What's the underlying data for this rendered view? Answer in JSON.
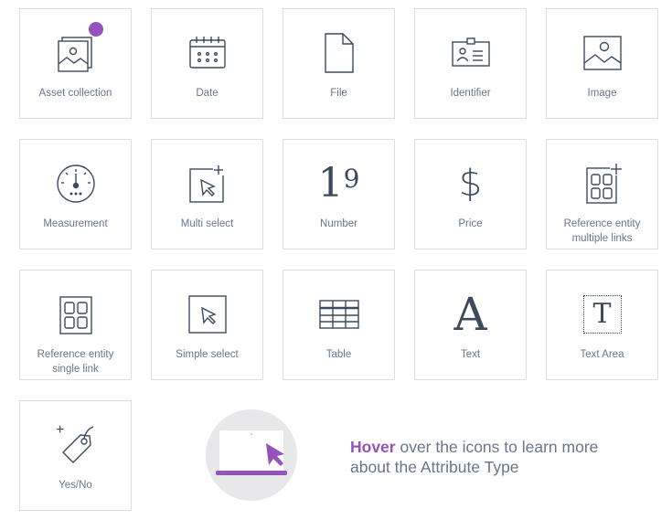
{
  "attribute_types": [
    {
      "id": "asset-collection",
      "label": "Asset collection",
      "icon": "asset-collection-icon",
      "selected": true
    },
    {
      "id": "date",
      "label": "Date",
      "icon": "calendar-icon"
    },
    {
      "id": "file",
      "label": "File",
      "icon": "file-icon"
    },
    {
      "id": "identifier",
      "label": "Identifier",
      "icon": "id-card-icon"
    },
    {
      "id": "image",
      "label": "Image",
      "icon": "image-icon"
    },
    {
      "id": "measurement",
      "label": "Measurement",
      "icon": "gauge-icon"
    },
    {
      "id": "multi-select",
      "label": "Multi select",
      "icon": "multi-select-icon"
    },
    {
      "id": "number",
      "label": "Number",
      "icon": "number-icon",
      "glyph_big": "1",
      "glyph_small": "9"
    },
    {
      "id": "price",
      "label": "Price",
      "icon": "dollar-icon",
      "glyph": "$"
    },
    {
      "id": "reference-entity-multiple",
      "label": "Reference entity\nmultiple links",
      "icon": "reference-multiple-icon"
    },
    {
      "id": "reference-entity-single",
      "label": "Reference entity\nsingle link",
      "icon": "reference-single-icon"
    },
    {
      "id": "simple-select",
      "label": "Simple select",
      "icon": "cursor-box-icon"
    },
    {
      "id": "table",
      "label": "Table",
      "icon": "table-icon"
    },
    {
      "id": "text",
      "label": "Text",
      "icon": "text-a-icon",
      "glyph": "A"
    },
    {
      "id": "text-area",
      "label": "Text Area",
      "icon": "text-area-icon",
      "glyph": "T"
    },
    {
      "id": "yes-no",
      "label": "Yes/No",
      "icon": "tag-icon",
      "glyph_plus": "+"
    }
  ],
  "hint": {
    "emphasis": "Hover",
    "text": " over the icons to learn more about the Attribute Type",
    "illustration_icon": "laptop-cursor-icon"
  },
  "colors": {
    "accent": "#9452ba",
    "text": "#67768a",
    "icon_stroke": "#3c4a5e",
    "border": "#dcdce2",
    "illus_bg": "#e8e8ea"
  }
}
